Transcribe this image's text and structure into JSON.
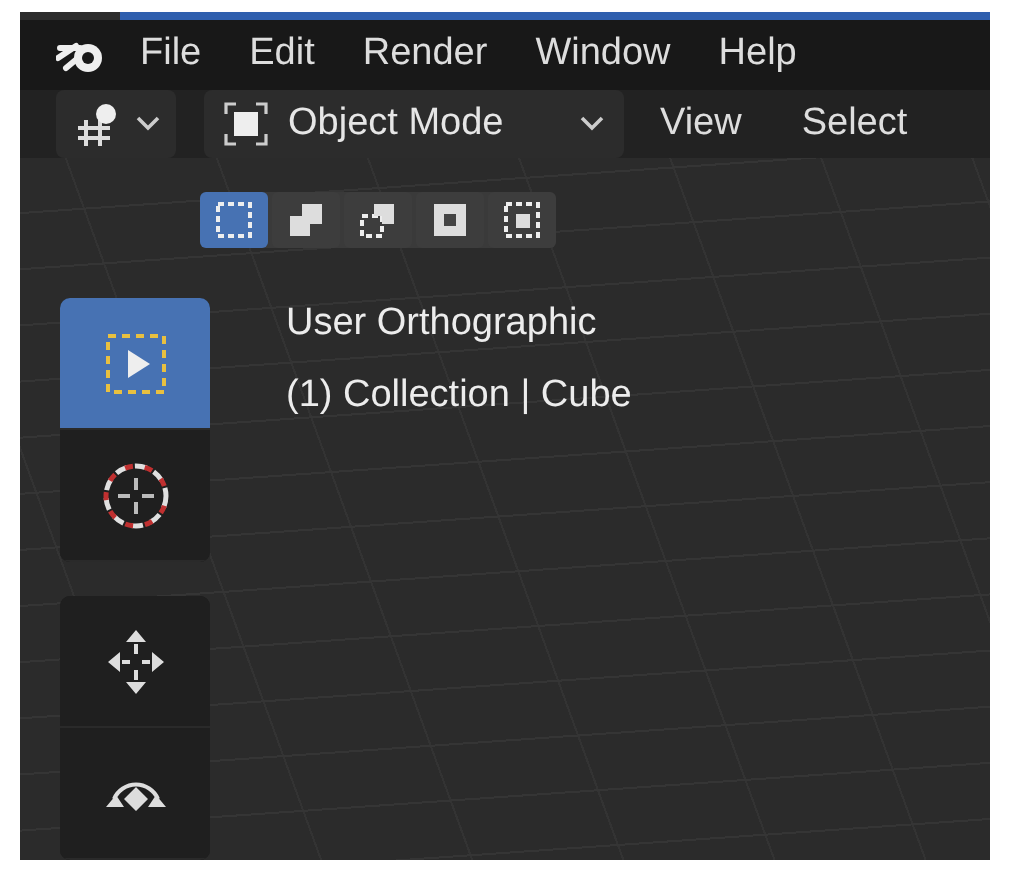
{
  "menu": [
    {
      "label": "File"
    },
    {
      "label": "Edit"
    },
    {
      "label": "Render"
    },
    {
      "label": "Window"
    },
    {
      "label": "Help"
    }
  ],
  "header": {
    "mode": "Object Mode",
    "menus": [
      "View",
      "Select"
    ]
  },
  "select_modes": [
    {
      "kind": "new",
      "selected": true
    },
    {
      "kind": "extend",
      "selected": false
    },
    {
      "kind": "subtract",
      "selected": false
    },
    {
      "kind": "invert",
      "selected": false
    },
    {
      "kind": "intersect",
      "selected": false
    }
  ],
  "tool_groups": [
    [
      {
        "kind": "select-box",
        "selected": true
      },
      {
        "kind": "cursor",
        "selected": false
      }
    ],
    [
      {
        "kind": "move",
        "selected": false
      },
      {
        "kind": "rotate",
        "selected": false
      }
    ]
  ],
  "viewport": {
    "lines": [
      "User Orthographic",
      "(1) Collection | Cube"
    ]
  }
}
